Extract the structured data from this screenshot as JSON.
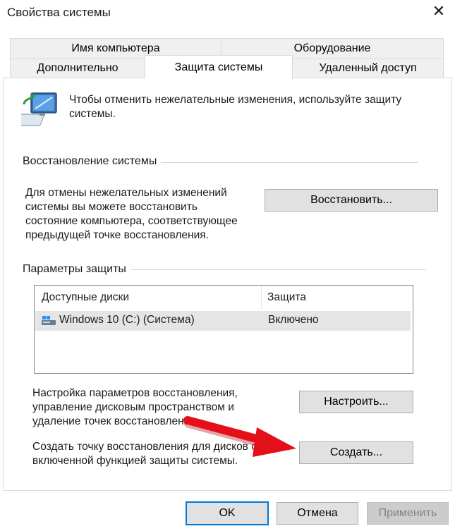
{
  "window": {
    "title": "Свойства системы",
    "close_glyph": "✕"
  },
  "tabs": {
    "row_top": [
      "Имя компьютера",
      "Оборудование"
    ],
    "row_bottom": [
      "Дополнительно",
      "Защита системы",
      "Удаленный доступ"
    ],
    "active": "Защита системы"
  },
  "intro": {
    "icon": "computer-shield-icon",
    "text": "Чтобы отменить нежелательные изменения, используйте защиту системы."
  },
  "restore_group": {
    "label": "Восстановление системы",
    "description": "Для отмены нежелательных изменений системы вы можете восстановить состояние компьютера, соответствующее предыдущей точке восстановления.",
    "button": "Восстановить..."
  },
  "protection_group": {
    "label": "Параметры защиты",
    "columns": [
      "Доступные диски",
      "Защита"
    ],
    "rows": [
      {
        "drive": "Windows 10 (C:) (Система)",
        "status": "Включено",
        "icon": "drive-icon"
      }
    ],
    "configure_text": "Настройка параметров восстановления, управление дисковым пространством и удаление точек восстановления.",
    "configure_button": "Настроить...",
    "create_text": "Создать точку восстановления для дисков с включенной функцией защиты системы.",
    "create_button": "Создать..."
  },
  "footer": {
    "ok": "OK",
    "cancel": "Отмена",
    "apply": "Применить"
  },
  "colors": {
    "accent": "#0078d7",
    "arrow": "#e3101a",
    "button_bg": "#e1e1e1"
  }
}
